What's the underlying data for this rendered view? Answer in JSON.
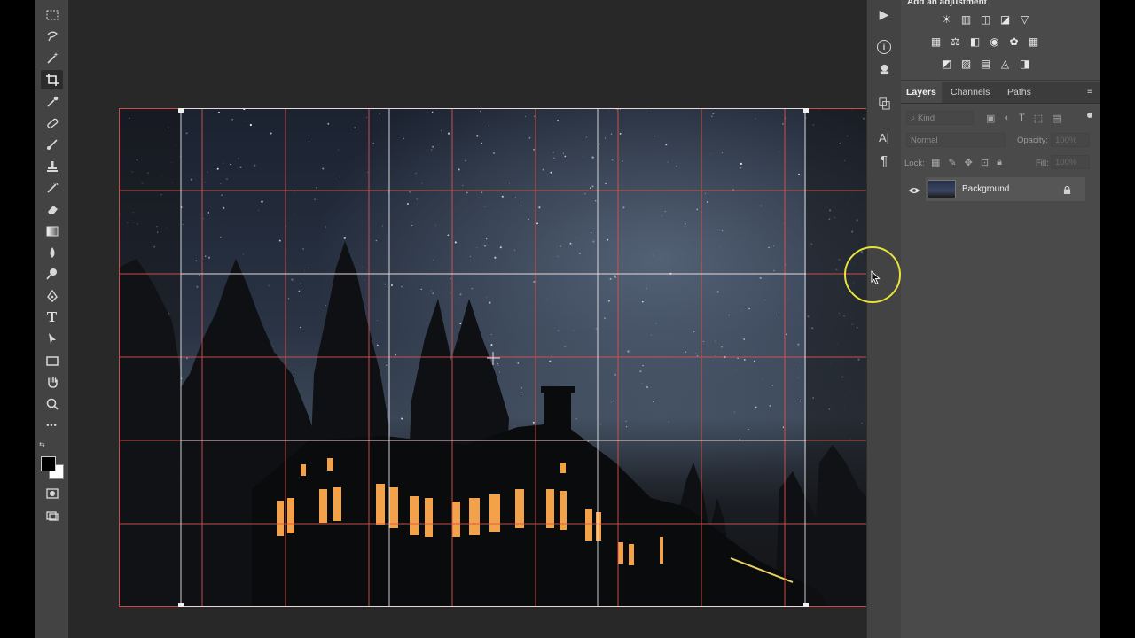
{
  "window": {
    "app_name": ""
  },
  "toolbar": {
    "tools": [
      {
        "name": "marquee-tool",
        "active": false
      },
      {
        "name": "lasso-tool",
        "active": false
      },
      {
        "name": "magic-wand-tool",
        "active": false
      },
      {
        "name": "crop-tool",
        "active": true
      },
      {
        "name": "eyedropper-tool",
        "active": false
      },
      {
        "name": "healing-brush-tool",
        "active": false
      },
      {
        "name": "brush-tool",
        "active": false
      },
      {
        "name": "clone-stamp-tool",
        "active": false
      },
      {
        "name": "history-brush-tool",
        "active": false
      },
      {
        "name": "eraser-tool",
        "active": false
      },
      {
        "name": "gradient-tool",
        "active": false
      },
      {
        "name": "blur-tool",
        "active": false
      },
      {
        "name": "dodge-tool",
        "active": false
      },
      {
        "name": "pen-tool",
        "active": false
      },
      {
        "name": "type-tool",
        "active": false
      },
      {
        "name": "path-selection-tool",
        "active": false
      },
      {
        "name": "rectangle-tool",
        "active": false
      },
      {
        "name": "hand-tool",
        "active": false
      },
      {
        "name": "zoom-tool",
        "active": false
      },
      {
        "name": "more-tools",
        "active": false
      }
    ],
    "type_glyph": "T",
    "more_glyph": "•••",
    "foreground_color": "#000000",
    "background_color": "#ffffff"
  },
  "canvas": {
    "crop_guide_color": "#d9534f",
    "crop_grid_color": "#ffffff"
  },
  "dock": {
    "icons": [
      "play-icon",
      "info-icon",
      "libraries-icon",
      "history-icon",
      "character-icon",
      "paragraph-icon"
    ],
    "char_glyph": "A|",
    "para_glyph": "¶",
    "play_glyph": "▶",
    "info_glyph": "i"
  },
  "adjustments": {
    "title": "Add an adjustment",
    "row1": [
      "☀",
      "▥",
      "◫",
      "◪",
      "▽"
    ],
    "row2": [
      "▦",
      "⚖",
      "◧",
      "◉",
      "✿",
      "▦"
    ],
    "row3": [
      "◩",
      "▨",
      "▤",
      "◬",
      "◨"
    ]
  },
  "layers_panel": {
    "tabs": [
      "Layers",
      "Channels",
      "Paths"
    ],
    "active_tab": "Layers",
    "filter_placeholder": "Kind",
    "blend_mode": "Normal",
    "opacity_label": "Opacity:",
    "opacity_value": "100%",
    "lock_label": "Lock:",
    "fill_label": "Fill:",
    "fill_value": "100%",
    "layers": [
      {
        "name": "Background",
        "visible": true,
        "locked": true
      }
    ]
  },
  "cursor": {
    "highlight_color": "#e8e13a"
  }
}
